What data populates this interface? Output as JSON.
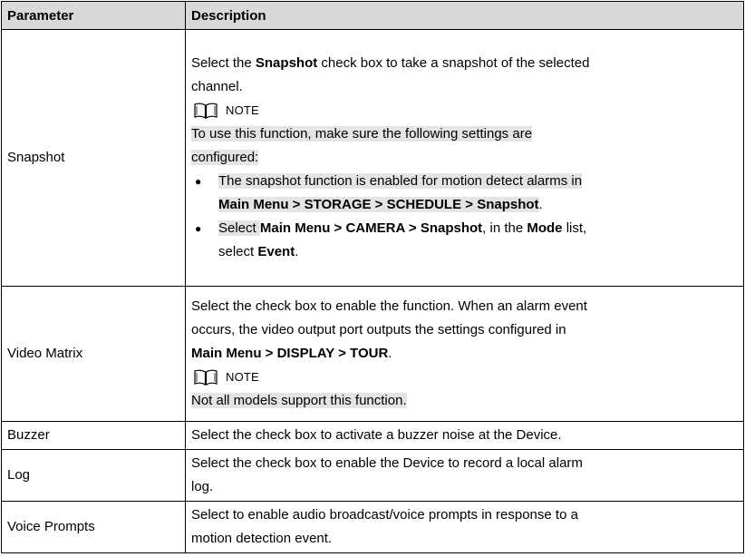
{
  "table": {
    "headers": {
      "parameter": "Parameter",
      "description": "Description"
    },
    "note_label": "NOTE",
    "snapshot": {
      "name": "Snapshot",
      "intro_pre": "Select the ",
      "intro_bold": "Snapshot",
      "intro_post1": " check box to take a snapshot of the selected",
      "intro_post2": "channel.",
      "note_text1": "To use this function, make sure the following settings are",
      "note_text2": "configured:",
      "bullet1_line1": "The snapshot function is enabled for motion detect alarms in",
      "bullet1_bold": "Main Menu > STORAGE > SCHEDULE > Snapshot",
      "bullet1_end": ".",
      "bullet2_pre": "Select ",
      "bullet2_bold1": "Main Menu > CAMERA > Snapshot",
      "bullet2_mid": ", in the ",
      "bullet2_bold2": "Mode",
      "bullet2_post": " list,",
      "bullet2_line2_pre": "select ",
      "bullet2_bold3": "Event",
      "bullet2_end": "."
    },
    "video_matrix": {
      "name": "Video Matrix",
      "line1": "Select the check box to enable the function. When an alarm event",
      "line2": "occurs, the video output port outputs the settings configured in",
      "line3_bold": "Main Menu > DISPLAY > TOUR",
      "line3_end": ".",
      "note_text": "Not all models support this function."
    },
    "buzzer": {
      "name": "Buzzer",
      "desc": "Select the check box to activate a buzzer noise at the Device."
    },
    "log": {
      "name": "Log",
      "line1": "Select the check box to enable the Device to record a local alarm",
      "line2": "log."
    },
    "voice_prompts": {
      "name": "Voice Prompts",
      "line1": "Select to enable audio broadcast/voice prompts in response to a",
      "line2": "motion detection event."
    }
  }
}
